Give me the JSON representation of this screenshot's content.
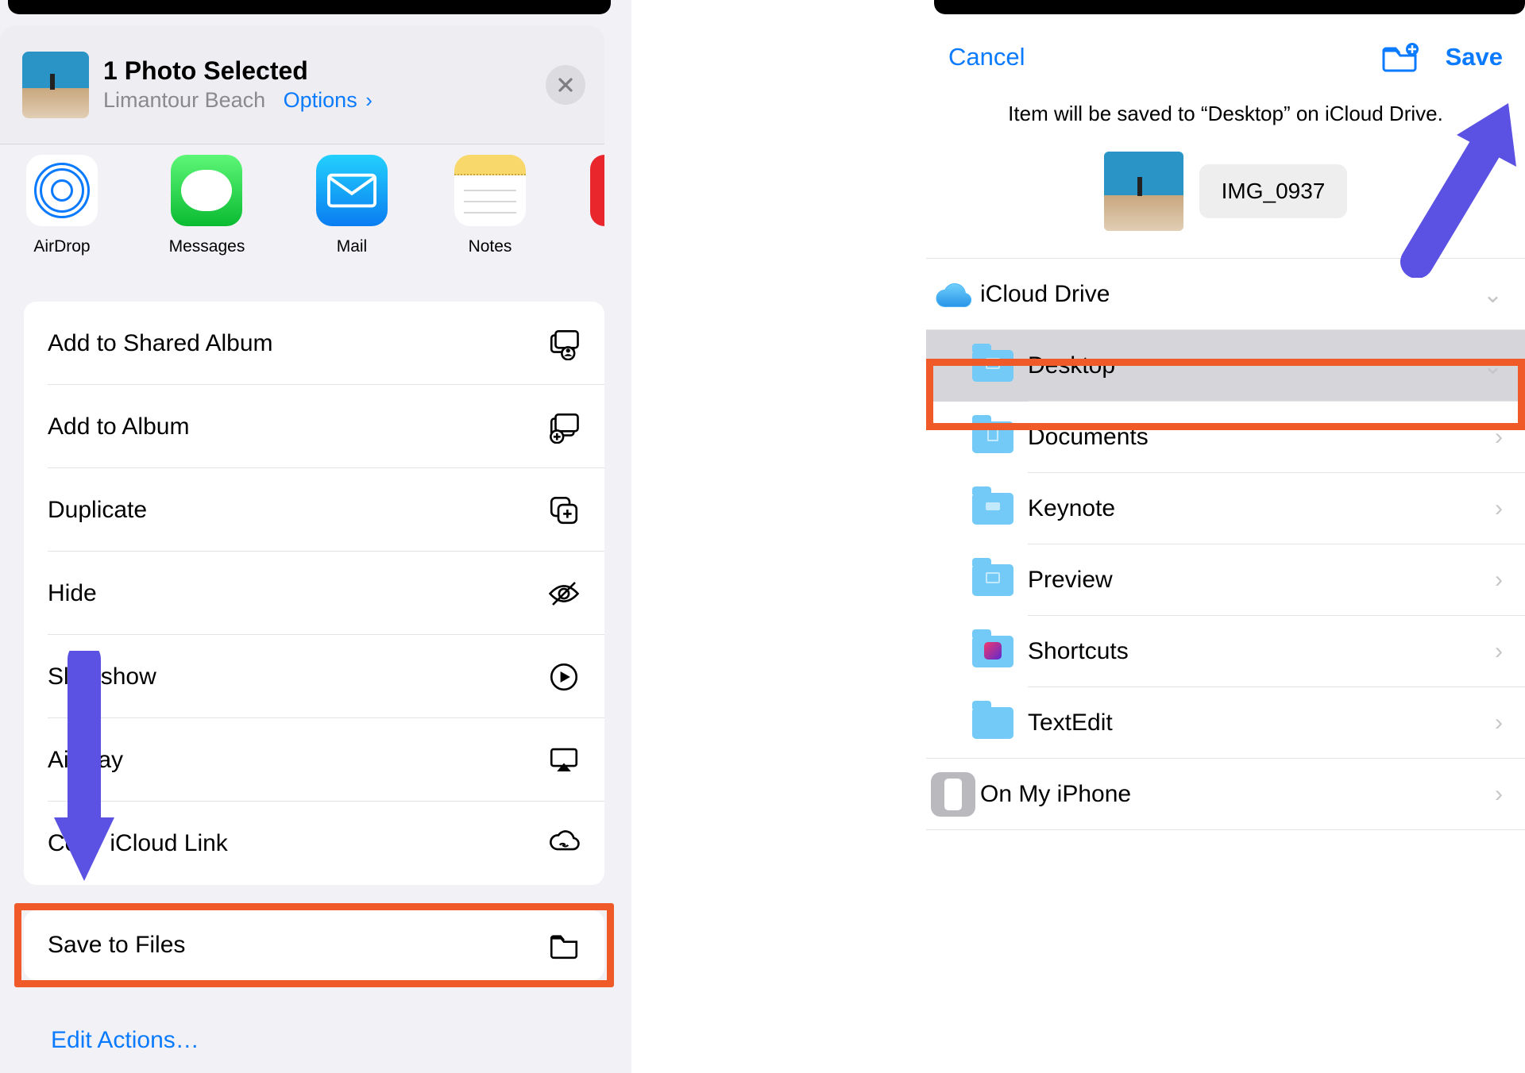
{
  "left": {
    "header": {
      "title": "1 Photo Selected",
      "subtitle_location": "Limantour Beach",
      "options_label": "Options",
      "chevron": "›"
    },
    "apps": {
      "airdrop": "AirDrop",
      "messages": "Messages",
      "mail": "Mail",
      "notes": "Notes"
    },
    "actions": {
      "shared_album": "Add to Shared Album",
      "album": "Add to Album",
      "duplicate": "Duplicate",
      "hide": "Hide",
      "slideshow": "Slideshow",
      "airplay": "AirPlay",
      "icloud_link": "Copy iCloud Link",
      "save_files": "Save to Files"
    },
    "edit_actions": "Edit Actions…"
  },
  "right": {
    "nav": {
      "cancel": "Cancel",
      "save": "Save"
    },
    "caption": "Item will be saved to “Desktop” on iCloud Drive.",
    "filename": "IMG_0937",
    "locations": {
      "icloud": "iCloud Drive",
      "desktop": "Desktop",
      "documents": "Documents",
      "keynote": "Keynote",
      "preview": "Preview",
      "shortcuts": "Shortcuts",
      "textedit": "TextEdit",
      "on_iphone": "On My iPhone"
    }
  }
}
